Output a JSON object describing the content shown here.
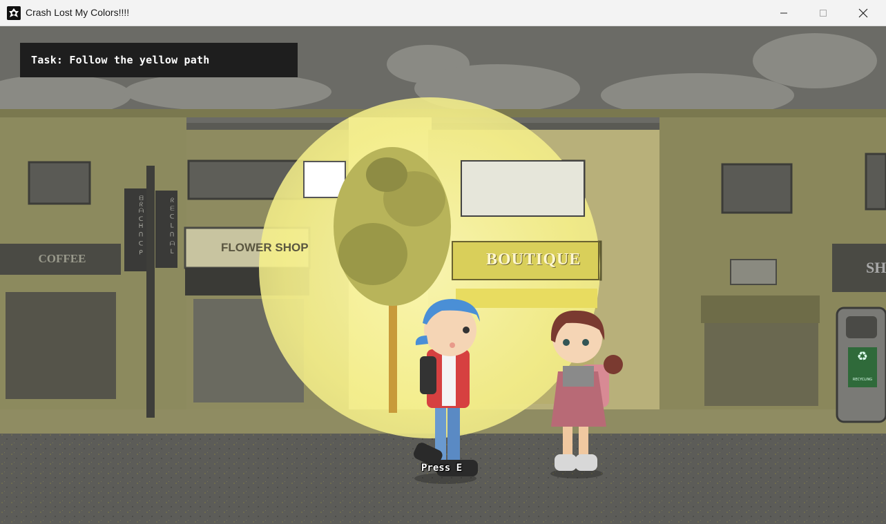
{
  "window": {
    "title": "Crash Lost My Colors!!!!",
    "controls": [
      "minimize-icon",
      "maximize-icon",
      "close-icon"
    ]
  },
  "hud": {
    "task_text": "Task: Follow the yellow path",
    "interact_prompt": "Press E"
  },
  "scene": {
    "shop_signs": {
      "coffee": "COFFEE",
      "flower_shop": "FLOWER SHOP",
      "boutique": "BOUTIQUE",
      "partial": "SH",
      "banner_left": "ᗺᖇᗩ ᑕᕼ ᑎ ᑕ ᑭ",
      "banner_right": "ᖇ ᗴ ᑕ ᒪ ᑎ ᗩ ᒪ",
      "recycling": "RECYCLING"
    },
    "characters": [
      "boy-with-blue-cap",
      "girl-with-pigtails"
    ]
  },
  "colors": {
    "spotlight": "#f6f08a",
    "desaturated_wall": "#8c8a5e",
    "road": "#585854",
    "hud_bg": "#1e1e1e"
  }
}
